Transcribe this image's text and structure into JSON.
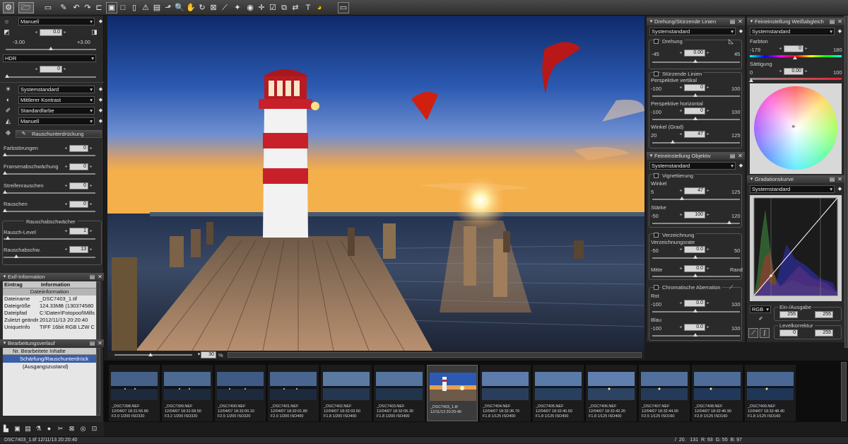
{
  "toolbar": {
    "icons": [
      "gear-icon",
      "folder-open-icon",
      "folder-icon",
      "brush-icon",
      "undo-icon",
      "redo-icon",
      "layout-full-icon",
      "layout-single-icon",
      "layout-double-icon",
      "warning-icon",
      "navigate-icon",
      "zoom-icon",
      "transform-icon",
      "rotate-icon",
      "brush-icon",
      "tone-icon",
      "crop-icon",
      "bookmark-icon",
      "batch-icon",
      "star-icon",
      "checkbox-icon",
      "compare-icon",
      "edit-icon",
      "text-icon",
      "settings-icon",
      "monitor-icon"
    ]
  },
  "left": {
    "exposure_mode": "Manuell",
    "exposure_value": "0.0",
    "exposure_min": "-3.00",
    "exposure_max": "+3.00",
    "hdr_mode": "HDR",
    "hdr_value": "0",
    "picture_control": "Systemstandard",
    "contrast": "Mittlerer Kontrast",
    "color": "Standardfarbe",
    "wb_mode": "Manuell",
    "noise_title": "Rauschunterdrückung",
    "noise_rows": [
      {
        "label": "Farbstörungen",
        "value": "0"
      },
      {
        "label": "Fransenabschwächung",
        "value": "0"
      },
      {
        "label": "Streifenrauschen",
        "value": "0"
      },
      {
        "label": "Rauschen",
        "value": "0"
      }
    ],
    "abschwaecher_title": "Rauschabschwächer",
    "rausch_level_label": "Rausch-Level",
    "rausch_level_value": "1",
    "rausch_abschw_label": "Rauschabschw.",
    "rausch_abschw_value": "13"
  },
  "exif": {
    "title": "Exif-Information",
    "col1": "Eintrag",
    "col2": "Information",
    "section": "Dateiinformation",
    "rows": [
      {
        "k": "Dateiname",
        "v": "_DSC7403_1.tif"
      },
      {
        "k": "Dateigröße",
        "v": "124.33MB (130374580"
      },
      {
        "k": "Dateipfad",
        "v": "C:\\Daten\\Fotopool\\Mills"
      },
      {
        "k": "Zuletzt geände",
        "v": "2012/11/13 20:20:40"
      },
      {
        "k": "UniqueInfo",
        "v": "TIFF 16bit RGB LZW C"
      }
    ]
  },
  "history": {
    "title": "Bearbeitungsverlauf",
    "header": "Nr. Bearbeitete Inhalte",
    "items": [
      "Schärfung/Rauschunterdrück",
      "(Ausgangszustand)"
    ]
  },
  "rot": {
    "title": "Drehung/Stürzende Linien",
    "preset": "Systemstandard",
    "drehung_label": "Drehung",
    "drehung_min": "-45",
    "drehung_value": "0.00",
    "drehung_max": "45",
    "stuerz_label": "Stürzende Linien",
    "pv_label": "Perspektive vertikal",
    "pv_min": "-100",
    "pv_value": "0",
    "pv_max": "100",
    "ph_label": "Perspektive horizontal",
    "ph_min": "-100",
    "ph_value": "0",
    "ph_max": "100",
    "winkel_label": "Winkel (Grad)",
    "winkel_min": "20",
    "winkel_value": "47",
    "winkel_max": "125"
  },
  "lens": {
    "title": "Feineinstellung Objektiv",
    "preset": "Systemstandard",
    "vig_label": "Vignettierung",
    "winkel_label": "Winkel",
    "winkel_min": "5",
    "winkel_value": "47",
    "winkel_max": "125",
    "staerke_label": "Stärke",
    "staerke_min": "-50",
    "staerke_value": "100",
    "staerke_max": "120",
    "verz_label": "Verzeichnung",
    "verzrate_label": "Verzeichnungsrate",
    "verzrate_min": "-50",
    "verzrate_value": "0.0",
    "verzrate_max": "50",
    "mitte_label": "Mitte",
    "mitte_value": "0.0",
    "rand_label": "Rand",
    "chrom_label": "Chromatische Aberration",
    "rot_label": "Rot",
    "rot_min": "-100",
    "rot_value": "0.0",
    "rot_max": "100",
    "blau_label": "Blau",
    "blau_min": "-100",
    "blau_value": "0.0",
    "blau_max": "100"
  },
  "wb": {
    "title": "Feineinstellung Weißabgleich",
    "preset": "Systemstandard",
    "farbton_label": "Farbton",
    "farbton_min": "-179",
    "farbton_value": "0",
    "farbton_max": "180",
    "saett_label": "Sättigung",
    "saett_min": "0",
    "saett_value": "0.00",
    "saett_max": "100"
  },
  "curve": {
    "title": "Gradationskurve",
    "preset": "Systemstandard",
    "channel": "RGB",
    "inout_label": "Ein-/Ausgabe",
    "in_value": "255",
    "out_value": "255",
    "level_label": "Levelkorrektur",
    "level_min": "0",
    "level_max": "255"
  },
  "viewer": {
    "zoom": "30",
    "zoom_unit": "%"
  },
  "film": {
    "items": [
      {
        "name": "_DSC7398.NEF",
        "date": "12/04/07 18:31:56.80",
        "info": "F2.0 1/200 ISO320"
      },
      {
        "name": "_DSC7399.NEF",
        "date": "12/04/07 18:31:58.50",
        "info": "F3.2 1/200 ISO320"
      },
      {
        "name": "_DSC7400.NEF",
        "date": "12/04/07 18:32:00.10",
        "info": "F2.5 1/200 ISO320"
      },
      {
        "name": "_DSC7401.NEF",
        "date": "12/04/07 18:32:01.80",
        "info": "F2.0 1/200 ISO400"
      },
      {
        "name": "_DSC7402.NEF",
        "date": "12/04/07 18:32:03.50",
        "info": "F1.8 1/200 ISO400"
      },
      {
        "name": "_DSC7403.NEF",
        "date": "12/04/07 18:32:05.30",
        "info": "F1.8 1/200 ISO400"
      },
      {
        "name": "_DSC7403_1.tif",
        "date": "12/11/13 20:20:40",
        "info": ""
      },
      {
        "name": "_DSC7404.NEF",
        "date": "12/04/07 18:32:36.70",
        "info": "F1.8 1/125 ISO400"
      },
      {
        "name": "_DSC7405.NEF",
        "date": "12/04/07 18:32:40.50",
        "info": "F1.8 1/125 ISO400"
      },
      {
        "name": "_DSC7406.NEF",
        "date": "12/04/07 18:32:42.20",
        "info": "F1.8 1/125 ISO400"
      },
      {
        "name": "_DSC7407.NEF",
        "date": "12/04/07 18:32:44.90",
        "info": "F2.5 1/125 ISO160"
      },
      {
        "name": "_DSC7408.NEF",
        "date": "12/04/07 18:32:46.90",
        "info": "F2.8 1/125 ISO160"
      },
      {
        "name": "_DSC7409.NEF",
        "date": "12/04/07 18:32:48.40",
        "info": "F1.8 1/125 ISO160"
      }
    ]
  },
  "status": {
    "left": "DSC7403_1.tif 12/11/13 20:20:40",
    "right": "/  20.   131  R: 93  G: 55  B: 97"
  },
  "colors": {
    "bg": "#1b1b1b",
    "panel": "#2a2a2a",
    "sky_top": "#1d3a7a",
    "sunset": "#f2a23a",
    "lighthouse_red": "#c8202a"
  }
}
